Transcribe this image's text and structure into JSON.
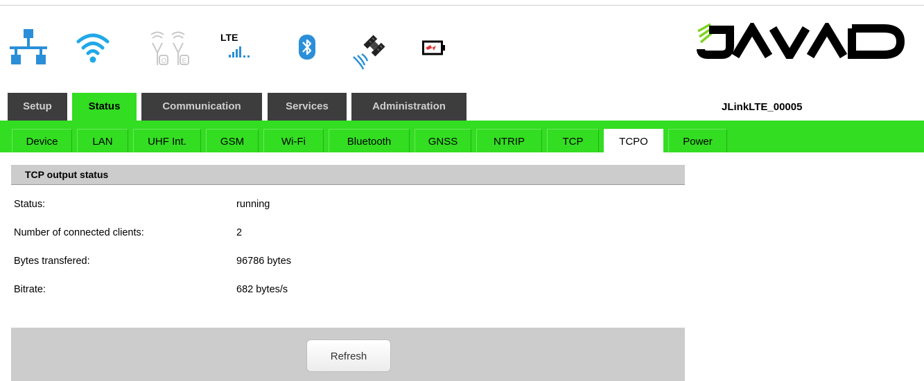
{
  "header": {
    "status_icons": [
      "lan-icon",
      "wifi-icon",
      "uhf-radio-icon",
      "lte-signal-icon",
      "bluetooth-icon",
      "gnss-satellite-icon",
      "battery-charging-icon"
    ],
    "lte_label": "LTE",
    "uhf_sub_labels": [
      "O",
      "E"
    ],
    "logo_text": "JAVAD",
    "device_name": "JLinkLTE_00005"
  },
  "main_tabs": [
    {
      "label": "Setup",
      "active": false
    },
    {
      "label": "Status",
      "active": true
    },
    {
      "label": "Communication",
      "active": false
    },
    {
      "label": "Services",
      "active": false
    },
    {
      "label": "Administration",
      "active": false
    }
  ],
  "sub_tabs": [
    {
      "label": "Device"
    },
    {
      "label": "LAN"
    },
    {
      "label": "UHF Int."
    },
    {
      "label": "GSM"
    },
    {
      "label": "Wi-Fi"
    },
    {
      "label": "Bluetooth"
    },
    {
      "label": "GNSS"
    },
    {
      "label": "NTRIP"
    },
    {
      "label": "TCP"
    },
    {
      "label": "TCPO",
      "selected": true
    },
    {
      "label": "Power"
    }
  ],
  "section": {
    "title": "TCP output status",
    "rows": [
      {
        "label": "Status:",
        "value": "running"
      },
      {
        "label": "Number of connected clients:",
        "value": "2"
      },
      {
        "label": "Bytes transfered:",
        "value": "96786 bytes"
      },
      {
        "label": "Bitrate:",
        "value": "682 bytes/s"
      }
    ]
  },
  "buttons": {
    "refresh": "Refresh"
  },
  "colors": {
    "accent_green": "#33dd22",
    "tab_dark": "#3d3d3d",
    "icon_blue": "#2a8fd8",
    "wifi_blue": "#20a8e8",
    "section_gray": "#cccccc"
  }
}
